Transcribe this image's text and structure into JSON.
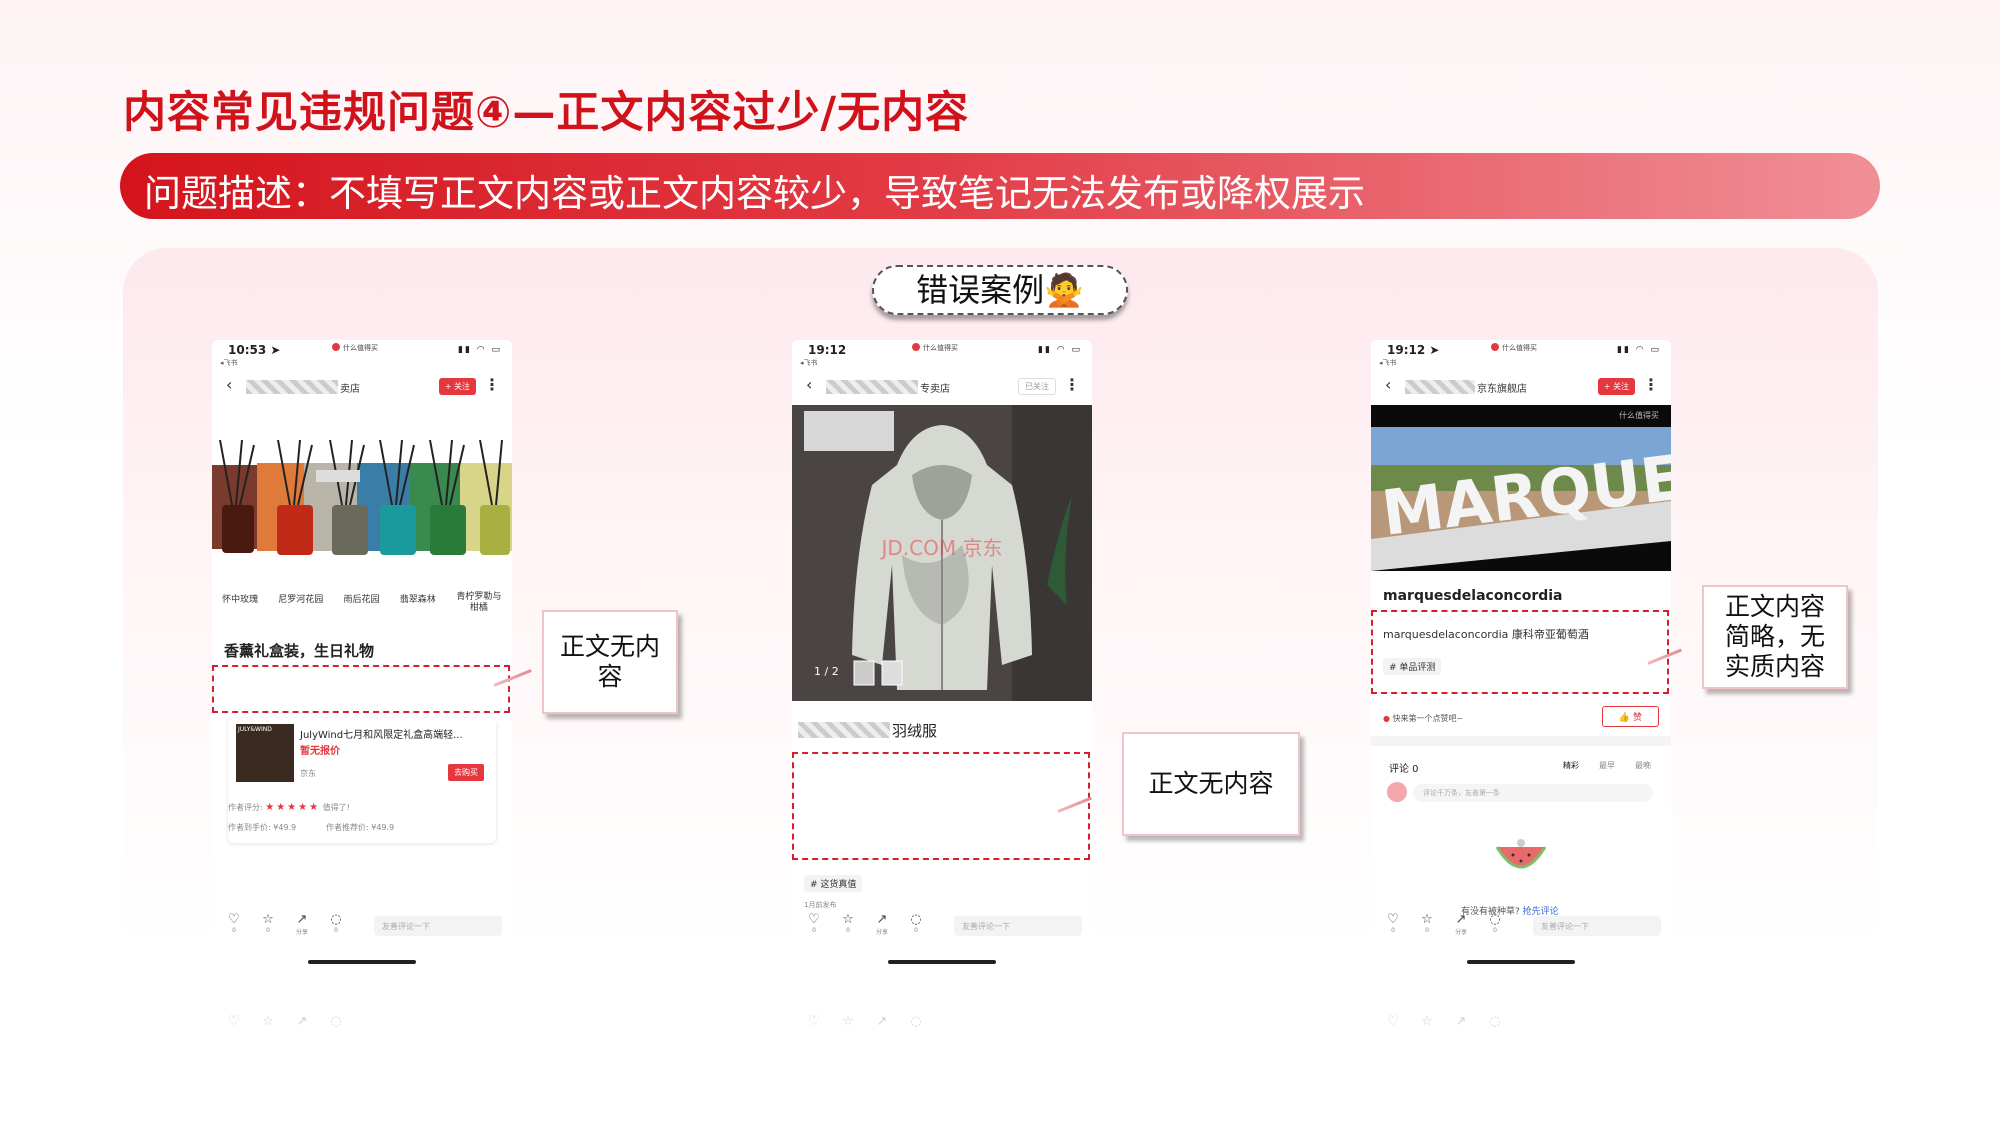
{
  "page": {
    "title": "内容常见违规问题④—正文内容过少/无内容",
    "description": "问题描述：不填写正文内容或正文内容较少，导致笔记无法发布或降权展示",
    "badge": "错误案例🙅"
  },
  "colors": {
    "accent": "#d0121b",
    "dashed_box": "#d81e2a",
    "button_red": "#e5383e"
  },
  "phones": [
    {
      "time": "10:53 ➤",
      "carrier": "◂飞书",
      "app_name": "什么值得买",
      "store_suffix": "卖店",
      "follow_label": "+ 关注",
      "product_labels": [
        "怀中玫瑰",
        "尼罗河花园",
        "雨后花园",
        "翡翠森林",
        "青柠罗勒与柑橘"
      ],
      "note_title": "香薰礼盒装，生日礼物",
      "product": {
        "brand_mark": "JULY&WIND",
        "name": "JulyWind七月和风限定礼盒高端轻...",
        "price": "暂无报价",
        "mall": "京东",
        "buy_label": "去购买",
        "rating_label": "作者评分:",
        "rating_comment": "值得了!",
        "price_paid": "作者到手价: ¥49.9",
        "price_recommend": "作者推荐价: ¥49.9"
      },
      "bottom": {
        "like": "0",
        "fav": "0",
        "share": "分享",
        "comment": "0",
        "comment_placeholder": "友善评论一下"
      },
      "callout": "正文无内容"
    },
    {
      "time": "19:12",
      "carrier": "◂飞书",
      "app_name": "什么值得买",
      "store_suffix": "专卖店",
      "follow_label": "已关注",
      "image_watermark": "JD.COM 京东",
      "image_counter": "1 / 2",
      "note_title_suffix": "羽绒服",
      "tag": "# 这货真值",
      "publish_time": "1月前发布",
      "bottom": {
        "like": "0",
        "fav": "0",
        "share": "分享",
        "comment": "0",
        "comment_placeholder": "友善评论一下"
      },
      "callout": "正文无内容"
    },
    {
      "time": "19:12 ➤",
      "carrier": "◂飞书",
      "app_name": "什么值得买",
      "store_suffix": "京东旗舰店",
      "follow_label": "+ 关注",
      "video_watermark": "什么值得买",
      "video_text": "MARQUES DE LA",
      "note_title": "marquesdelaconcordia",
      "note_body": "marquesdelaconcordia 康科帝亚葡萄酒",
      "tag": "# 单品评测",
      "first_like_prompt": "快来第一个点赞吧~",
      "like_button": "赞",
      "comments": {
        "header": "评论 0",
        "tabs": [
          "精彩",
          "最早",
          "最晚"
        ],
        "input_placeholder": "评论千万条，友善第一条",
        "empty_text": "有没有被种草?",
        "empty_link": "抢先评论"
      },
      "bottom": {
        "like": "0",
        "fav": "0",
        "share": "分享",
        "comment": "0",
        "comment_placeholder": "友善评论一下"
      },
      "callout": "正文内容简略，无实质内容"
    }
  ]
}
